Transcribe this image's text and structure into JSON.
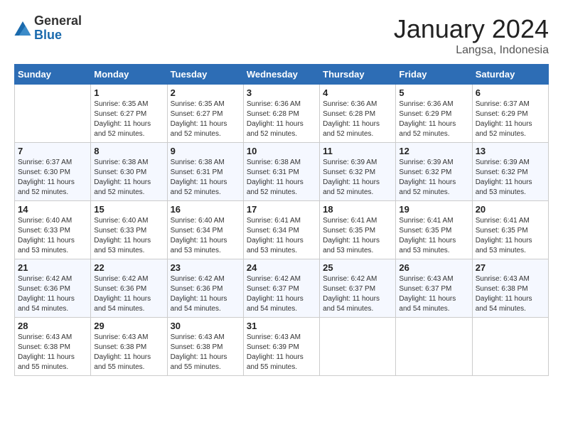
{
  "header": {
    "logo_general": "General",
    "logo_blue": "Blue",
    "month": "January 2024",
    "location": "Langsa, Indonesia"
  },
  "weekdays": [
    "Sunday",
    "Monday",
    "Tuesday",
    "Wednesday",
    "Thursday",
    "Friday",
    "Saturday"
  ],
  "weeks": [
    [
      {
        "num": "",
        "sunrise": "",
        "sunset": "",
        "daylight": ""
      },
      {
        "num": "1",
        "sunrise": "6:35 AM",
        "sunset": "6:27 PM",
        "daylight": "11 hours and 52 minutes."
      },
      {
        "num": "2",
        "sunrise": "6:35 AM",
        "sunset": "6:27 PM",
        "daylight": "11 hours and 52 minutes."
      },
      {
        "num": "3",
        "sunrise": "6:36 AM",
        "sunset": "6:28 PM",
        "daylight": "11 hours and 52 minutes."
      },
      {
        "num": "4",
        "sunrise": "6:36 AM",
        "sunset": "6:28 PM",
        "daylight": "11 hours and 52 minutes."
      },
      {
        "num": "5",
        "sunrise": "6:36 AM",
        "sunset": "6:29 PM",
        "daylight": "11 hours and 52 minutes."
      },
      {
        "num": "6",
        "sunrise": "6:37 AM",
        "sunset": "6:29 PM",
        "daylight": "11 hours and 52 minutes."
      }
    ],
    [
      {
        "num": "7",
        "sunrise": "6:37 AM",
        "sunset": "6:30 PM",
        "daylight": "11 hours and 52 minutes."
      },
      {
        "num": "8",
        "sunrise": "6:38 AM",
        "sunset": "6:30 PM",
        "daylight": "11 hours and 52 minutes."
      },
      {
        "num": "9",
        "sunrise": "6:38 AM",
        "sunset": "6:31 PM",
        "daylight": "11 hours and 52 minutes."
      },
      {
        "num": "10",
        "sunrise": "6:38 AM",
        "sunset": "6:31 PM",
        "daylight": "11 hours and 52 minutes."
      },
      {
        "num": "11",
        "sunrise": "6:39 AM",
        "sunset": "6:32 PM",
        "daylight": "11 hours and 52 minutes."
      },
      {
        "num": "12",
        "sunrise": "6:39 AM",
        "sunset": "6:32 PM",
        "daylight": "11 hours and 52 minutes."
      },
      {
        "num": "13",
        "sunrise": "6:39 AM",
        "sunset": "6:32 PM",
        "daylight": "11 hours and 53 minutes."
      }
    ],
    [
      {
        "num": "14",
        "sunrise": "6:40 AM",
        "sunset": "6:33 PM",
        "daylight": "11 hours and 53 minutes."
      },
      {
        "num": "15",
        "sunrise": "6:40 AM",
        "sunset": "6:33 PM",
        "daylight": "11 hours and 53 minutes."
      },
      {
        "num": "16",
        "sunrise": "6:40 AM",
        "sunset": "6:34 PM",
        "daylight": "11 hours and 53 minutes."
      },
      {
        "num": "17",
        "sunrise": "6:41 AM",
        "sunset": "6:34 PM",
        "daylight": "11 hours and 53 minutes."
      },
      {
        "num": "18",
        "sunrise": "6:41 AM",
        "sunset": "6:35 PM",
        "daylight": "11 hours and 53 minutes."
      },
      {
        "num": "19",
        "sunrise": "6:41 AM",
        "sunset": "6:35 PM",
        "daylight": "11 hours and 53 minutes."
      },
      {
        "num": "20",
        "sunrise": "6:41 AM",
        "sunset": "6:35 PM",
        "daylight": "11 hours and 53 minutes."
      }
    ],
    [
      {
        "num": "21",
        "sunrise": "6:42 AM",
        "sunset": "6:36 PM",
        "daylight": "11 hours and 54 minutes."
      },
      {
        "num": "22",
        "sunrise": "6:42 AM",
        "sunset": "6:36 PM",
        "daylight": "11 hours and 54 minutes."
      },
      {
        "num": "23",
        "sunrise": "6:42 AM",
        "sunset": "6:36 PM",
        "daylight": "11 hours and 54 minutes."
      },
      {
        "num": "24",
        "sunrise": "6:42 AM",
        "sunset": "6:37 PM",
        "daylight": "11 hours and 54 minutes."
      },
      {
        "num": "25",
        "sunrise": "6:42 AM",
        "sunset": "6:37 PM",
        "daylight": "11 hours and 54 minutes."
      },
      {
        "num": "26",
        "sunrise": "6:43 AM",
        "sunset": "6:37 PM",
        "daylight": "11 hours and 54 minutes."
      },
      {
        "num": "27",
        "sunrise": "6:43 AM",
        "sunset": "6:38 PM",
        "daylight": "11 hours and 54 minutes."
      }
    ],
    [
      {
        "num": "28",
        "sunrise": "6:43 AM",
        "sunset": "6:38 PM",
        "daylight": "11 hours and 55 minutes."
      },
      {
        "num": "29",
        "sunrise": "6:43 AM",
        "sunset": "6:38 PM",
        "daylight": "11 hours and 55 minutes."
      },
      {
        "num": "30",
        "sunrise": "6:43 AM",
        "sunset": "6:38 PM",
        "daylight": "11 hours and 55 minutes."
      },
      {
        "num": "31",
        "sunrise": "6:43 AM",
        "sunset": "6:39 PM",
        "daylight": "11 hours and 55 minutes."
      },
      {
        "num": "",
        "sunrise": "",
        "sunset": "",
        "daylight": ""
      },
      {
        "num": "",
        "sunrise": "",
        "sunset": "",
        "daylight": ""
      },
      {
        "num": "",
        "sunrise": "",
        "sunset": "",
        "daylight": ""
      }
    ]
  ]
}
